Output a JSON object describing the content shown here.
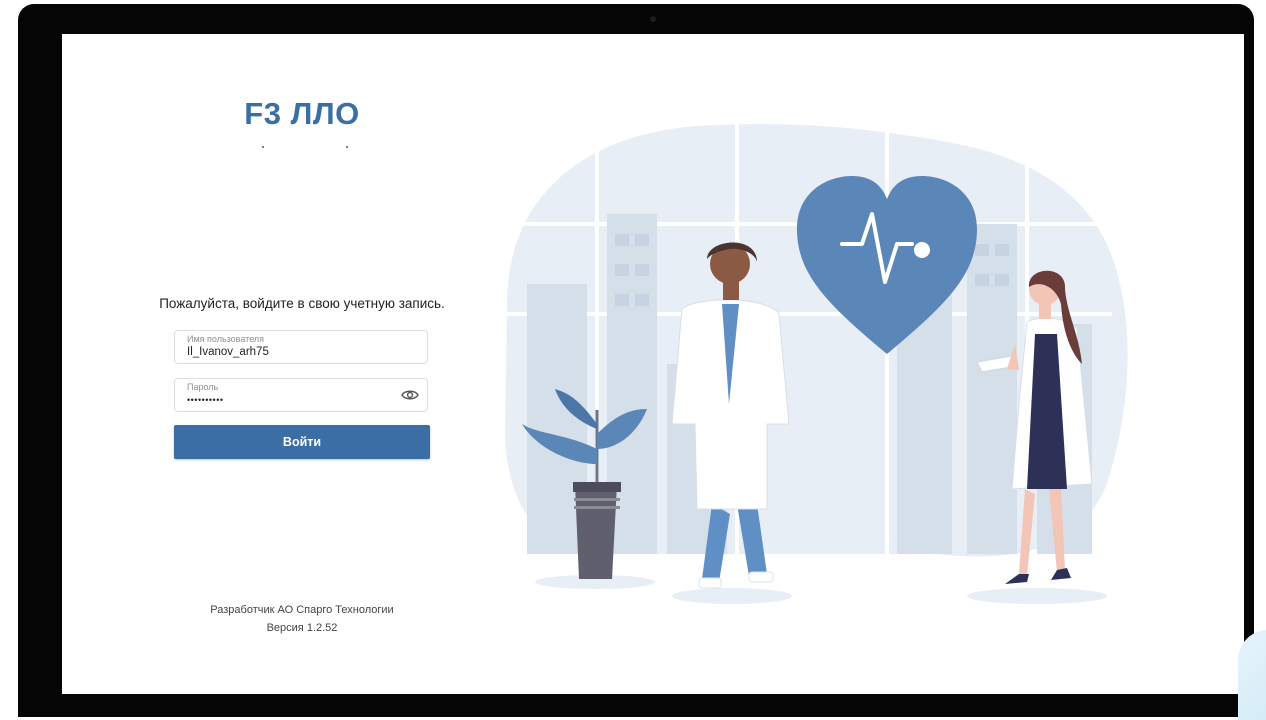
{
  "app": {
    "title": "F3 ЛЛО"
  },
  "login": {
    "prompt": "Пожалуйста, войдите в свою учетную запись.",
    "username": {
      "label": "Имя пользователя",
      "value": "Il_Ivanov_arh75"
    },
    "password": {
      "label": "Пароль",
      "value": "••••••••••",
      "toggle_icon": "eye-icon"
    },
    "submit_label": "Войти"
  },
  "footer": {
    "developer": "Разработчик АО Спарго Технологии",
    "version": "Версия 1.2.52"
  },
  "colors": {
    "accent": "#3a6ea5",
    "illustration_bg": "#e8eef5",
    "heart": "#5b86b8"
  }
}
